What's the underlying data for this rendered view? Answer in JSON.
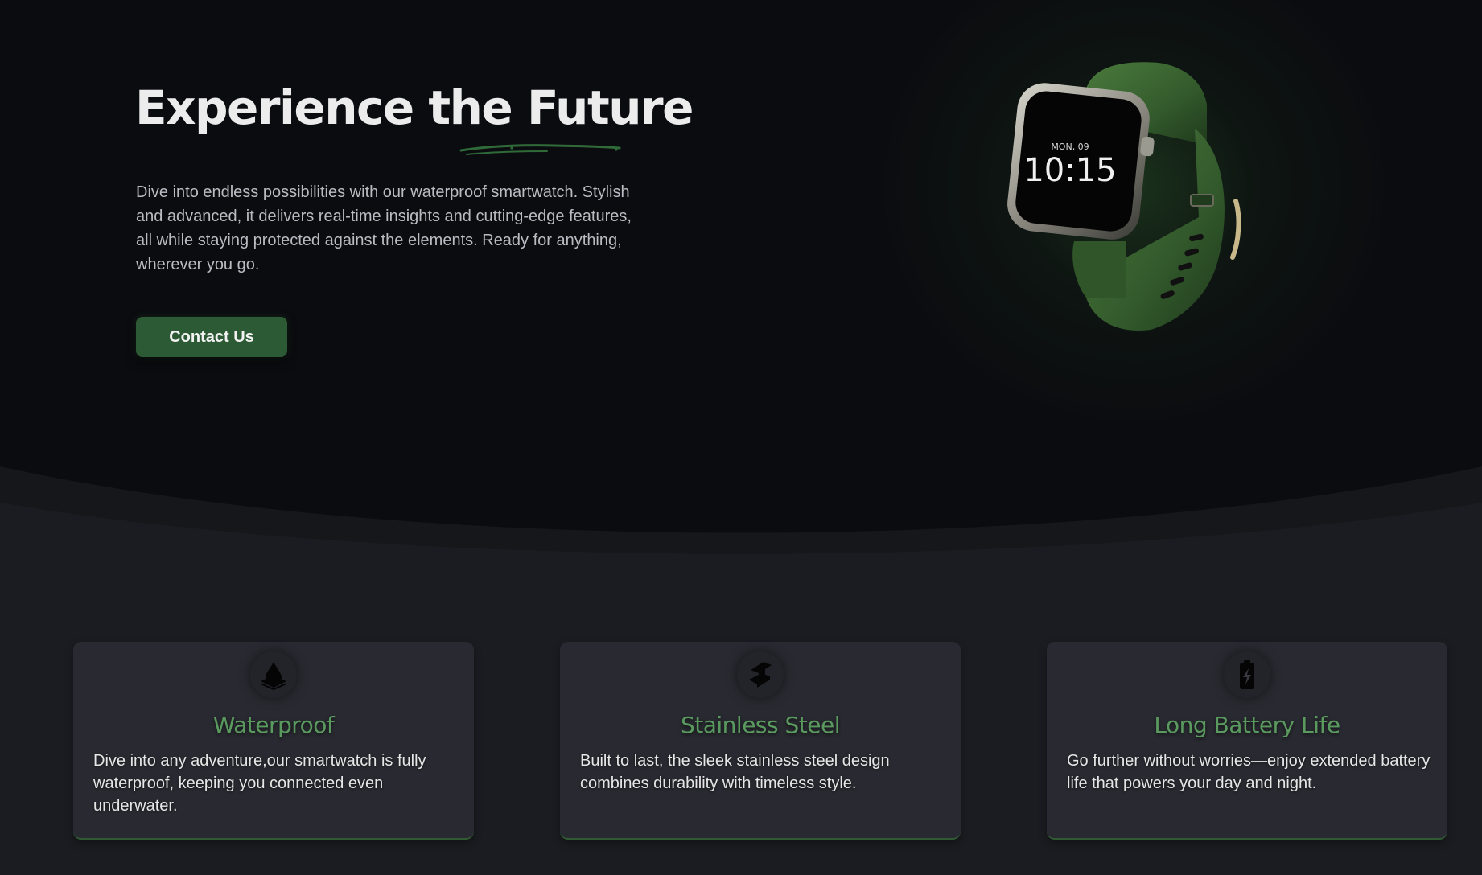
{
  "hero": {
    "title": "Experience the Future",
    "description": "Dive into endless possibilities with our waterproof smartwatch. Stylish and advanced, it delivers real-time insights and cutting-edge features, all while staying protected against the elements. Ready for anything, wherever you go.",
    "cta_label": "Contact Us",
    "watch": {
      "date": "MON, 09",
      "time": "10:15"
    }
  },
  "features": [
    {
      "icon": "water-drop-icon",
      "title": "Waterproof",
      "text": "Dive into any adventure,our smartwatch is fully waterproof, keeping you connected even underwater."
    },
    {
      "icon": "steel-beam-icon",
      "title": "Stainless Steel",
      "text": "Built to last, the sleek stainless steel design combines durability with timeless style."
    },
    {
      "icon": "battery-icon",
      "title": "Long Battery Life",
      "text": "Go further without worries—enjoy extended battery life that powers your day and night."
    }
  ],
  "colors": {
    "accent": "#2c5a34",
    "feature_title": "#5a9a5f",
    "hero_background": "#0b0c10",
    "section_background": "#1b1c21",
    "card_background": "#292a31"
  }
}
